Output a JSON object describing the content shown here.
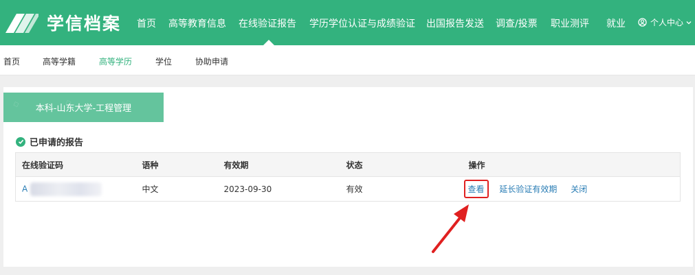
{
  "brand": {
    "name": "学信档案"
  },
  "topnav": {
    "items": [
      {
        "label": "首页"
      },
      {
        "label": "高等教育信息"
      },
      {
        "label": "在线验证报告"
      },
      {
        "label": "学历学位认证与成绩验证"
      },
      {
        "label": "出国报告发送"
      },
      {
        "label": "调查/投票"
      },
      {
        "label": "职业测评"
      },
      {
        "label": "就业"
      }
    ],
    "active": "在线验证报告",
    "user_center": "个人中心"
  },
  "subnav": {
    "items": [
      {
        "label": "首页"
      },
      {
        "label": "高等学籍"
      },
      {
        "label": "高等学历"
      },
      {
        "label": "学位"
      },
      {
        "label": "协助申请"
      }
    ],
    "active": "高等学历"
  },
  "card": {
    "school_tab": "本科-山东大学-工程管理",
    "section_title": "已申请的报告",
    "table": {
      "headers": [
        "在线验证码",
        "语种",
        "有效期",
        "状态",
        "操作"
      ],
      "rows": [
        {
          "code_prefix": "A",
          "language": "中文",
          "expiry": "2023-09-30",
          "status": "有效",
          "actions": {
            "view": "查看",
            "extend": "延长验证有效期",
            "close": "关闭"
          }
        }
      ]
    }
  },
  "colors": {
    "primary_green": "#33b27e",
    "tab_green": "#64c49d",
    "link_blue": "#2a7db5",
    "highlight_red": "#e02020"
  },
  "icons": [
    "logo-book-icon",
    "user-circle-icon",
    "caret-down-icon",
    "check-circle-icon",
    "red-arrow-icon"
  ]
}
